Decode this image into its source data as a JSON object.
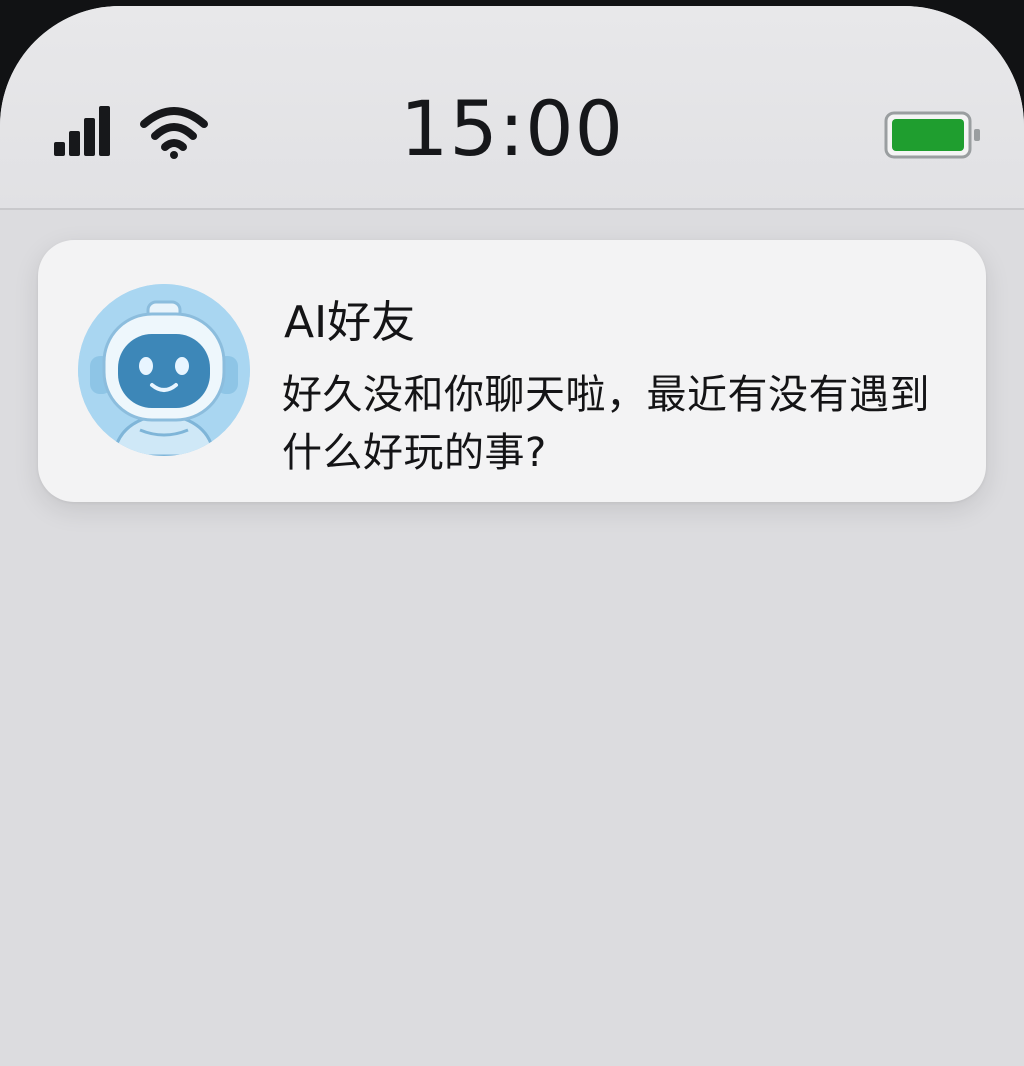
{
  "status_bar": {
    "time": "15:00",
    "signal_icon": "cellular-signal-icon",
    "wifi_icon": "wifi-icon",
    "battery_icon": "battery-icon",
    "battery_color": "#1f9e2f",
    "battery_level": 1.0
  },
  "notification": {
    "avatar_icon": "robot-avatar",
    "sender": "AI好友",
    "message": "好久没和你聊天啦，最近有没有遇到什么好玩的事?"
  }
}
